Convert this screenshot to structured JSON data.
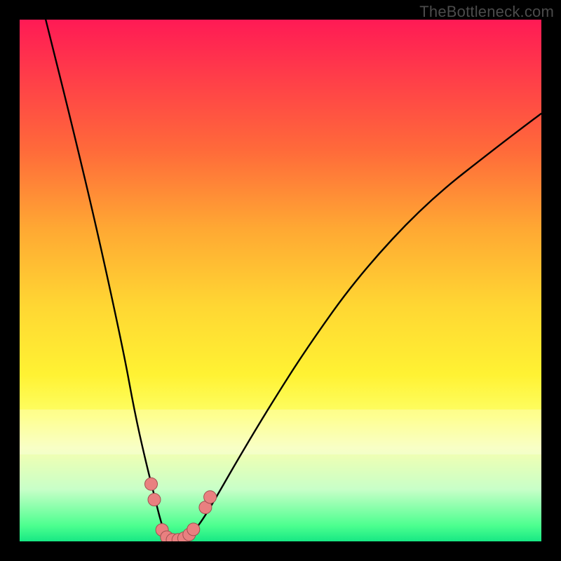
{
  "watermark": "TheBottleneck.com",
  "colors": {
    "frame": "#000000",
    "curve_stroke": "#000000",
    "marker_fill": "#e98080",
    "marker_stroke": "#a05050"
  },
  "chart_data": {
    "type": "line",
    "title": "",
    "xlabel": "",
    "ylabel": "",
    "xlim": [
      0,
      100
    ],
    "ylim": [
      0,
      100
    ],
    "grid": false,
    "legend": false,
    "series": [
      {
        "name": "bottleneck-curve",
        "x": [
          5,
          10,
          15,
          20,
          22,
          24,
          26,
          27,
          28,
          29,
          30,
          31,
          32,
          33,
          35,
          38,
          42,
          48,
          55,
          65,
          78,
          92,
          100
        ],
        "values": [
          100,
          80,
          59,
          36,
          25,
          16,
          8,
          4,
          1,
          0,
          0,
          0,
          0.5,
          1.5,
          4,
          9,
          16,
          26,
          37,
          51,
          65,
          76,
          82
        ]
      }
    ],
    "markers": {
      "name": "highlight-points",
      "points": [
        {
          "x": 25.2,
          "y": 11
        },
        {
          "x": 25.8,
          "y": 8
        },
        {
          "x": 27.3,
          "y": 2.2
        },
        {
          "x": 28.2,
          "y": 0.8
        },
        {
          "x": 29.3,
          "y": 0.3
        },
        {
          "x": 30.4,
          "y": 0.3
        },
        {
          "x": 31.5,
          "y": 0.6
        },
        {
          "x": 32.5,
          "y": 1.3
        },
        {
          "x": 33.3,
          "y": 2.3
        },
        {
          "x": 35.6,
          "y": 6.5
        },
        {
          "x": 36.5,
          "y": 8.5
        }
      ]
    }
  }
}
